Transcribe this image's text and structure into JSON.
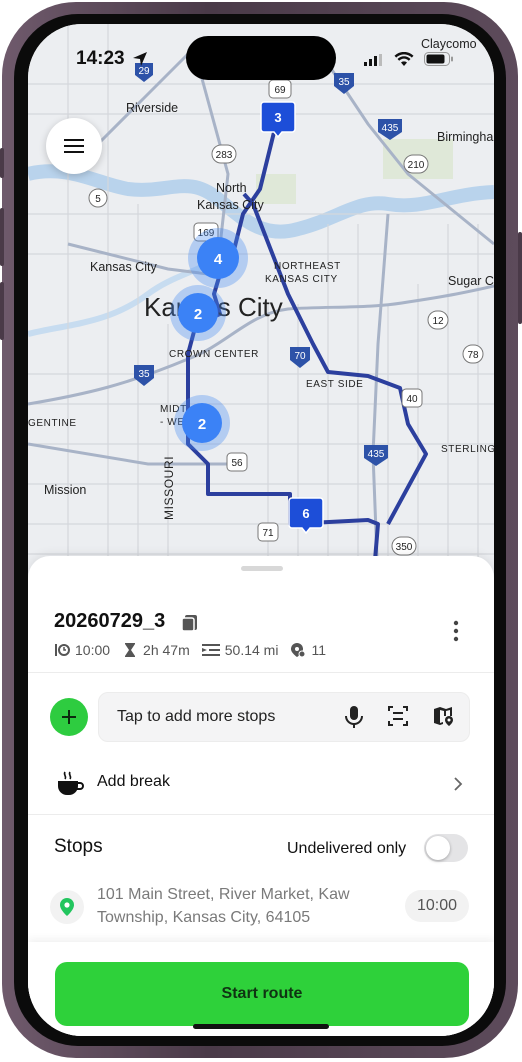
{
  "status": {
    "time": "14:23"
  },
  "map": {
    "labels": {
      "riverside": "Riverside",
      "north_kc": "North\nKansas City",
      "kansas_city_ks": "Kansas City",
      "kansas_city": "Kansas City",
      "northeast_kc_1": "NORTHEAST",
      "northeast_kc_2": "KANSAS CITY",
      "crown_center": "CROWN CENTER",
      "east_side": "EAST SIDE",
      "midtown": "MIDT",
      "west": "- WES",
      "missouri": "MISSOURI",
      "mission": "Mission",
      "argentine": "GENTINE",
      "sterling": "STERLING",
      "sugar_creek": "Sugar C",
      "birmingham": "Birmingha",
      "claycomo": "Claycomo"
    },
    "shields": [
      "29",
      "69",
      "35",
      "283",
      "435",
      "210",
      "5",
      "169",
      "12",
      "70",
      "78",
      "40",
      "56",
      "71",
      "350",
      "35"
    ],
    "clusters": [
      {
        "count": "4"
      },
      {
        "count": "2"
      },
      {
        "count": "2"
      }
    ],
    "markers": [
      {
        "number": "3"
      },
      {
        "number": "6"
      }
    ]
  },
  "sheet": {
    "route_name": "20260729_3",
    "meta": {
      "start_time": "10:00",
      "duration": "2h 47m",
      "distance": "50.14 mi",
      "stops": "11"
    },
    "add_stops_placeholder": "Tap to add more stops",
    "add_break_label": "Add break",
    "stops_label": "Stops",
    "undelivered_label": "Undelivered only",
    "undelivered_on": false,
    "stop": {
      "address": "101 Main Street, River Market, Kaw Township, Kansas City, 64105",
      "time": "10:00"
    },
    "start_button": "Start route"
  },
  "colors": {
    "accent_green": "#2ed13a",
    "route_blue": "#2c3f9e",
    "marker_blue": "#1d4ed8"
  }
}
